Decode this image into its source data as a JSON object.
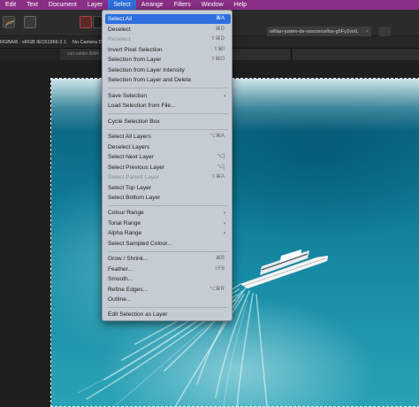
{
  "menubar": {
    "items": [
      "Edit",
      "Text",
      "Document",
      "Layer",
      "Select",
      "Arrange",
      "Filters",
      "Window",
      "Help"
    ],
    "active": "Select",
    "colors": {
      "bar": "#8a2e86",
      "active": "#2d6fde"
    }
  },
  "toolbar": {
    "user_chip": "willian-justen-de-vasconcellos-g5FyZvoIL",
    "user_chip_close": "×",
    "icons": [
      "chart-icon",
      "grid-icon",
      "red-swatch-icon",
      "dark-swatch-icon"
    ]
  },
  "context": {
    "profile": "RGBA/8 · sRGB IEC61966-2.1",
    "camera": "No Camera D"
  },
  "document": {
    "tab_label": "cart-solder-BAN"
  },
  "select_menu": {
    "items": [
      {
        "label": "Select All",
        "shortcut": "⌘A",
        "highlight": true
      },
      {
        "label": "Deselect",
        "shortcut": "⌘D"
      },
      {
        "label": "Reselect",
        "shortcut": "⇧⌘D",
        "disabled": true
      },
      {
        "label": "Invert Pixel Selection",
        "shortcut": "⇧⌘I"
      },
      {
        "label": "Selection from Layer",
        "shortcut": "⇧⌘O"
      },
      {
        "label": "Selection from Layer Intensity"
      },
      {
        "label": "Selection from Layer and Delete"
      },
      {
        "label": "Save Selection",
        "submenu": true
      },
      {
        "label": "Load Selection from File..."
      },
      {
        "label": "Cycle Selection Box"
      },
      {
        "label": "Select All Layers",
        "shortcut": "⌥⌘A"
      },
      {
        "label": "Deselect Layers"
      },
      {
        "label": "Select Next Layer",
        "shortcut": "⌥]"
      },
      {
        "label": "Select Previous Layer",
        "shortcut": "⌥["
      },
      {
        "label": "Select Parent Layer",
        "shortcut": "⇧⌘A",
        "disabled": true
      },
      {
        "label": "Select Top Layer"
      },
      {
        "label": "Select Bottom Layer"
      },
      {
        "label": "Colour Range",
        "submenu": true
      },
      {
        "label": "Tonal Range",
        "submenu": true
      },
      {
        "label": "Alpha Range",
        "submenu": true
      },
      {
        "label": "Select Sampled Colour..."
      },
      {
        "label": "Grow / Shrink...",
        "shortcut": "⌘B"
      },
      {
        "label": "Feather...",
        "shortcut": "⇧F6"
      },
      {
        "label": "Smooth..."
      },
      {
        "label": "Refine Edges...",
        "shortcut": "⌥⌘R"
      },
      {
        "label": "Outline..."
      },
      {
        "label": "Edit Selection as Layer"
      }
    ],
    "submenu_arrow": "›",
    "colors": {
      "background": "#c6ccd3",
      "highlight": "#2f6fe0"
    }
  }
}
